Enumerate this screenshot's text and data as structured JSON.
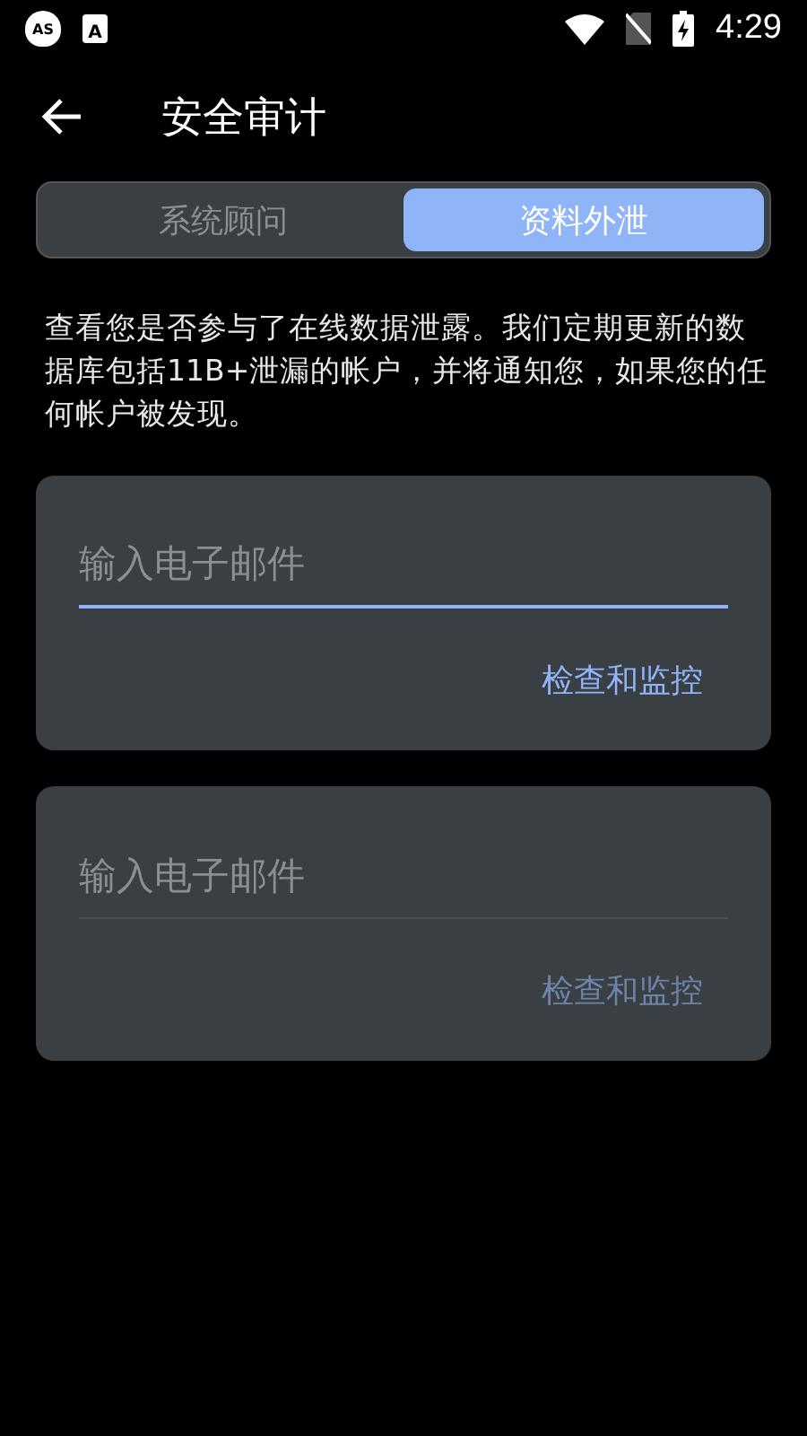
{
  "status_bar": {
    "left_icons": [
      {
        "kind": "shield",
        "text": "AS"
      },
      {
        "kind": "app",
        "text": "A"
      }
    ],
    "time": "4:29"
  },
  "app_bar": {
    "title": "安全审计"
  },
  "tabs": [
    {
      "label": "系统顾问",
      "selected": false
    },
    {
      "label": "资料外泄",
      "selected": true
    }
  ],
  "description": "查看您是否参与了在线数据泄露。我们定期更新的数据库包括11B+泄漏的帐户，并将通知您，如果您的任何帐户被发现。",
  "cards": [
    {
      "field": {
        "placeholder": "输入电子邮件",
        "focused": true
      },
      "button": {
        "label": "检查和监控",
        "disabled": false
      }
    },
    {
      "field": {
        "placeholder": "输入电子邮件",
        "focused": false
      },
      "button": {
        "label": "检查和监控",
        "disabled": true
      }
    }
  ]
}
